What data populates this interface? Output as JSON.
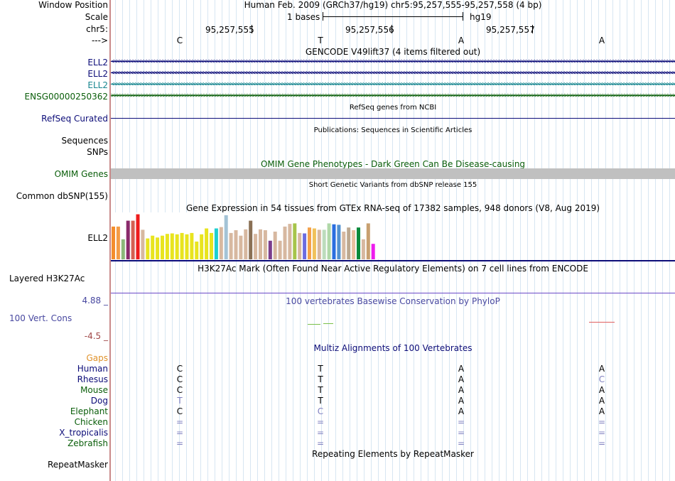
{
  "header": {
    "window_position_label": "Window Position",
    "window_position_text": "Human Feb. 2009 (GRCh37/hg19)   chr5:95,257,555-95,257,558 (4 bp)",
    "scale_label": "Scale",
    "scale_text": "1 bases",
    "scale_assembly": "hg19",
    "chr_label": "chr5:",
    "coords": [
      "95,257,555",
      "95,257,556",
      "95,257,557"
    ],
    "strand_label": "--->",
    "bases": [
      "C",
      "T",
      "A",
      "A"
    ]
  },
  "gencode": {
    "title": "GENCODE V49lift37 (4 items filtered out)",
    "tracks": [
      {
        "label": "ELL2",
        "color": "#0c0c78",
        "dir": "<"
      },
      {
        "label": "ELL2",
        "color": "#0c0c78",
        "dir": "<"
      },
      {
        "label": "ELL2",
        "color": "#17868f",
        "dir": "<"
      },
      {
        "label": "ENSG00000250362",
        "color": "#0a5e0a",
        "dir": ">"
      }
    ]
  },
  "refseq": {
    "title": "RefSeq genes from NCBI",
    "label": "RefSeq Curated",
    "color": "#0c0c78"
  },
  "publications": {
    "title": "Publications: Sequences in Scientific Articles",
    "label1": "Sequences",
    "label2": "SNPs"
  },
  "omim": {
    "title": "OMIM Gene Phenotypes - Dark Green Can Be Disease-causing",
    "label": "OMIM Genes",
    "color": "#0a5e0a",
    "bar_color": "#c0c0c0"
  },
  "dbsnp": {
    "title": "Short Genetic Variants from dbSNP release 155",
    "label": "Common dbSNP(155)"
  },
  "gtex": {
    "title": "Gene Expression in 54 tissues from GTEx RNA-seq of 17382 samples, 948 donors (V8, Aug 2019)",
    "label": "ELL2",
    "bars": [
      {
        "v": 0.72,
        "c": "#f48d2c"
      },
      {
        "v": 0.72,
        "c": "#f49c46"
      },
      {
        "v": 0.44,
        "c": "#8cb87a"
      },
      {
        "v": 0.85,
        "c": "#8a2a6a"
      },
      {
        "v": 0.85,
        "c": "#d45f52"
      },
      {
        "v": 0.99,
        "c": "#ee1c1c"
      },
      {
        "v": 0.65,
        "c": "#d7b8a0"
      },
      {
        "v": 0.46,
        "c": "#e8e41e"
      },
      {
        "v": 0.52,
        "c": "#e8e41e"
      },
      {
        "v": 0.48,
        "c": "#e8e41e"
      },
      {
        "v": 0.52,
        "c": "#e8e41e"
      },
      {
        "v": 0.56,
        "c": "#e8e41e"
      },
      {
        "v": 0.57,
        "c": "#e8e41e"
      },
      {
        "v": 0.55,
        "c": "#e8e41e"
      },
      {
        "v": 0.58,
        "c": "#e8e41e"
      },
      {
        "v": 0.55,
        "c": "#e8e41e"
      },
      {
        "v": 0.58,
        "c": "#e8e41e"
      },
      {
        "v": 0.39,
        "c": "#e8e41e"
      },
      {
        "v": 0.55,
        "c": "#e8e41e"
      },
      {
        "v": 0.68,
        "c": "#e8e41e"
      },
      {
        "v": 0.58,
        "c": "#e8e41e"
      },
      {
        "v": 0.68,
        "c": "#1ecfd0"
      },
      {
        "v": 0.71,
        "c": "#d7b8a0"
      },
      {
        "v": 0.97,
        "c": "#a3c3d6"
      },
      {
        "v": 0.58,
        "c": "#d7b8a0"
      },
      {
        "v": 0.64,
        "c": "#d7b8a0"
      },
      {
        "v": 0.52,
        "c": "#d7b8a0"
      },
      {
        "v": 0.66,
        "c": "#d7b8a0"
      },
      {
        "v": 0.85,
        "c": "#8a7055"
      },
      {
        "v": 0.56,
        "c": "#d7b8a0"
      },
      {
        "v": 0.66,
        "c": "#d7b8a0"
      },
      {
        "v": 0.64,
        "c": "#d7b8a0"
      },
      {
        "v": 0.41,
        "c": "#7a3c8c"
      },
      {
        "v": 0.61,
        "c": "#d7b8a0"
      },
      {
        "v": 0.41,
        "c": "#d7b8a0"
      },
      {
        "v": 0.72,
        "c": "#d7b8a0"
      },
      {
        "v": 0.78,
        "c": "#d7b8a0"
      },
      {
        "v": 0.79,
        "c": "#a6c44a"
      },
      {
        "v": 0.58,
        "c": "#d7b8a0"
      },
      {
        "v": 0.57,
        "c": "#6c6ce0"
      },
      {
        "v": 0.7,
        "c": "#f4a14a"
      },
      {
        "v": 0.68,
        "c": "#f0c15a"
      },
      {
        "v": 0.65,
        "c": "#d7b8a0"
      },
      {
        "v": 0.65,
        "c": "#bcdcbc"
      },
      {
        "v": 0.79,
        "c": "#b0d8a8"
      },
      {
        "v": 0.77,
        "c": "#2a6ee0"
      },
      {
        "v": 0.76,
        "c": "#5090d0"
      },
      {
        "v": 0.61,
        "c": "#d7b8a0"
      },
      {
        "v": 0.7,
        "c": "#bca890"
      },
      {
        "v": 0.64,
        "c": "#e8c0a0"
      },
      {
        "v": 0.7,
        "c": "#0c8a3c"
      },
      {
        "v": 0.44,
        "c": "#d7b8a0"
      },
      {
        "v": 0.79,
        "c": "#c8a070"
      },
      {
        "v": 0.34,
        "c": "#ee1cee"
      }
    ]
  },
  "h3k27ac": {
    "title": "H3K27Ac Mark (Often Found Near Active Regulatory Elements) on 7 cell lines from ENCODE",
    "label": "Layered H3K27Ac"
  },
  "phylop": {
    "title": "100 vertebrates Basewise Conservation by PhyloP",
    "label": "100 Vert. Cons",
    "ymax": "4.88 _",
    "ymin": "-4.5 _",
    "color": "#4848a0",
    "ymax_color": "#4848a0",
    "ymin_color": "#a04848"
  },
  "multiz": {
    "title": "Multiz Alignments of 100 Vertebrates",
    "gaps_label": "Gaps",
    "species": [
      {
        "name": "Human",
        "color": "#0c0c78",
        "bases": [
          "C",
          "T",
          "A",
          "A"
        ]
      },
      {
        "name": "Rhesus",
        "color": "#0c0c78",
        "bases": [
          "C",
          "T",
          "A",
          "C"
        ]
      },
      {
        "name": "Mouse",
        "color": "#0a5e0a",
        "bases": [
          "C",
          "T",
          "A",
          "A"
        ]
      },
      {
        "name": "Dog",
        "color": "#0c0c78",
        "bases": [
          "T",
          "T",
          "A",
          "A"
        ]
      },
      {
        "name": "Elephant",
        "color": "#0a5e0a",
        "bases": [
          "C",
          "C",
          "A",
          "A"
        ]
      },
      {
        "name": "Chicken",
        "color": "#0a5e0a",
        "bases": [
          "=",
          "=",
          "=",
          "="
        ]
      },
      {
        "name": "X_tropicalis",
        "color": "#0c0c78",
        "bases": [
          "=",
          "=",
          "=",
          "="
        ]
      },
      {
        "name": "Zebrafish",
        "color": "#0a5e0a",
        "bases": [
          "=",
          "=",
          "=",
          "="
        ]
      }
    ]
  },
  "repeatmasker": {
    "title": "Repeating Elements by RepeatMasker",
    "label": "RepeatMasker"
  }
}
